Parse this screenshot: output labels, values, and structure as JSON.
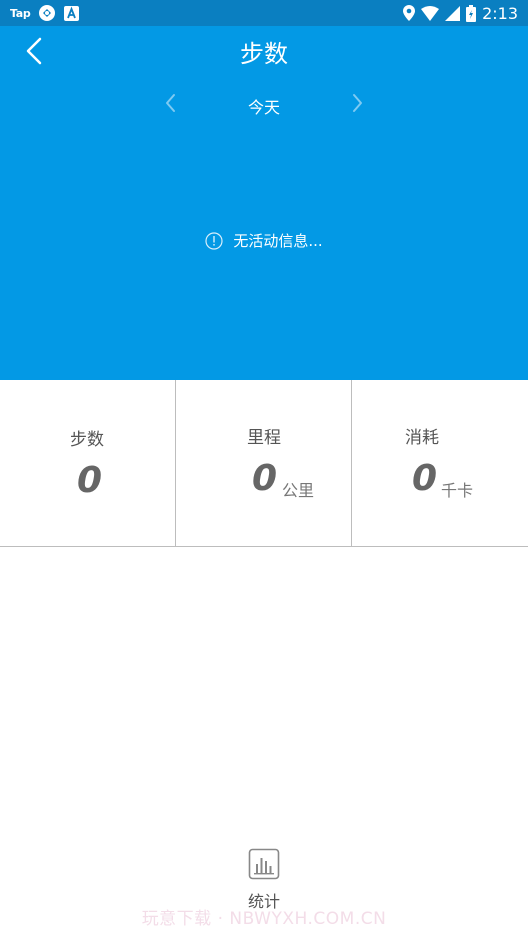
{
  "status_bar": {
    "app_label": "Tap",
    "time": "2:13"
  },
  "header": {
    "title": "步数"
  },
  "date_nav": {
    "label": "今天"
  },
  "activity": {
    "empty_message": "无活动信息..."
  },
  "stats": {
    "steps": {
      "label": "步数",
      "value": "0"
    },
    "distance": {
      "label": "里程",
      "value": "0",
      "unit": "公里"
    },
    "calories": {
      "label": "消耗",
      "value": "0",
      "unit": "千卡"
    }
  },
  "bottom": {
    "stats_tab_label": "统计"
  },
  "watermark": "玩意下载 · NBWYXH.COM.CN",
  "colors": {
    "status_bar": "#0a7fc1",
    "primary": "#0399e5"
  }
}
